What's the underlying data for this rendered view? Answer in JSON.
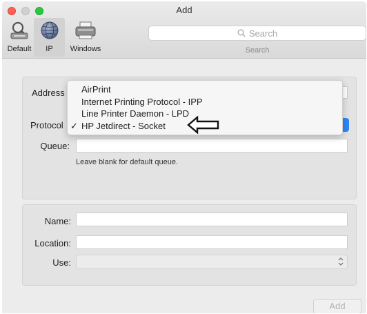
{
  "window": {
    "title": "Add"
  },
  "toolbar": {
    "default_label": "Default",
    "ip_label": "IP",
    "windows_label": "Windows",
    "search_placeholder": "Search",
    "search_label": "Search"
  },
  "form": {
    "address_label": "Address",
    "protocol_label": "Protocol",
    "queue_label": "Queue:",
    "queue_value": "",
    "queue_hint": "Leave blank for default queue.",
    "name_label": "Name:",
    "name_value": "",
    "location_label": "Location:",
    "location_value": "",
    "use_label": "Use:",
    "use_value": ""
  },
  "protocol_menu": {
    "items": [
      {
        "label": "AirPrint",
        "checked": false
      },
      {
        "label": "Internet Printing Protocol - IPP",
        "checked": false
      },
      {
        "label": "Line Printer Daemon - LPD",
        "checked": false
      },
      {
        "label": "HP Jetdirect - Socket",
        "checked": true
      }
    ],
    "check_glyph": "✓"
  },
  "footer": {
    "add_button": "Add"
  },
  "icons": {
    "default": "magnifier-printer-icon",
    "ip": "globe-icon",
    "windows": "printer-icon",
    "search": "search-icon",
    "pointer": "left-arrow-icon",
    "use_select": "up-down-chevron-icon"
  },
  "colors": {
    "accent": "#2f86f5",
    "close": "#ff5f57",
    "maximize": "#28c940"
  }
}
